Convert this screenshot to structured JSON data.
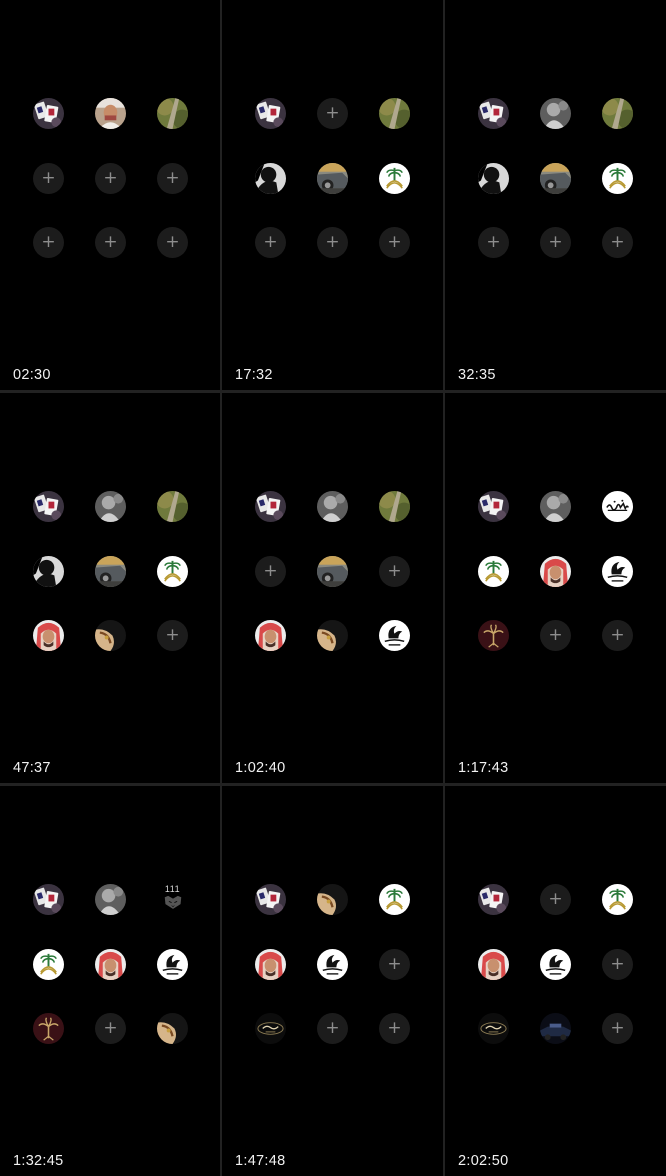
{
  "icons": {
    "empty": "plus-icon"
  },
  "avatar_names": {
    "cards": "cards-avatar",
    "man-portrait": "man-portrait-avatar",
    "road": "road-avatar",
    "gray-figure": "gray-figure-avatar",
    "silhouette": "silhouette-avatar",
    "car": "car-avatar",
    "emblem": "saudi-emblem-avatar",
    "red-ghutra": "red-ghutra-avatar",
    "dagger": "dagger-avatar",
    "calligraphy": "calligraphy-avatar",
    "falcon": "falcon-logo-avatar",
    "palm": "palm-avatar",
    "tiger": "tiger-111-avatar",
    "dark-logo": "dark-logo-avatar",
    "dark-car": "dark-car-avatar"
  },
  "tiger_text": "111",
  "frames": [
    {
      "timestamp": "02:30",
      "slots": [
        "cards",
        "man-portrait",
        "road",
        "empty",
        "empty",
        "empty",
        "empty",
        "empty",
        "empty"
      ]
    },
    {
      "timestamp": "17:32",
      "slots": [
        "cards",
        "empty",
        "road",
        "silhouette",
        "car",
        "emblem",
        "empty",
        "empty",
        "empty"
      ]
    },
    {
      "timestamp": "32:35",
      "slots": [
        "cards",
        "gray-figure",
        "road",
        "silhouette",
        "car",
        "emblem",
        "empty",
        "empty",
        "empty"
      ]
    },
    {
      "timestamp": "47:37",
      "slots": [
        "cards",
        "gray-figure",
        "road",
        "silhouette",
        "car",
        "emblem",
        "red-ghutra",
        "dagger",
        "empty"
      ]
    },
    {
      "timestamp": "1:02:40",
      "slots": [
        "cards",
        "gray-figure",
        "road",
        "empty",
        "car",
        "empty",
        "red-ghutra",
        "dagger",
        "falcon"
      ]
    },
    {
      "timestamp": "1:17:43",
      "slots": [
        "cards",
        "gray-figure",
        "calligraphy",
        "emblem",
        "red-ghutra",
        "falcon",
        "palm",
        "empty",
        "empty"
      ]
    },
    {
      "timestamp": "1:32:45",
      "slots": [
        "cards",
        "gray-figure",
        "tiger",
        "emblem",
        "red-ghutra",
        "falcon",
        "palm",
        "empty",
        "dagger"
      ]
    },
    {
      "timestamp": "1:47:48",
      "slots": [
        "cards",
        "dagger",
        "emblem",
        "red-ghutra",
        "falcon",
        "empty",
        "dark-logo",
        "empty",
        "empty"
      ]
    },
    {
      "timestamp": "2:02:50",
      "slots": [
        "cards",
        "empty",
        "emblem",
        "red-ghutra",
        "falcon",
        "empty",
        "dark-logo",
        "dark-car",
        "empty"
      ]
    }
  ]
}
